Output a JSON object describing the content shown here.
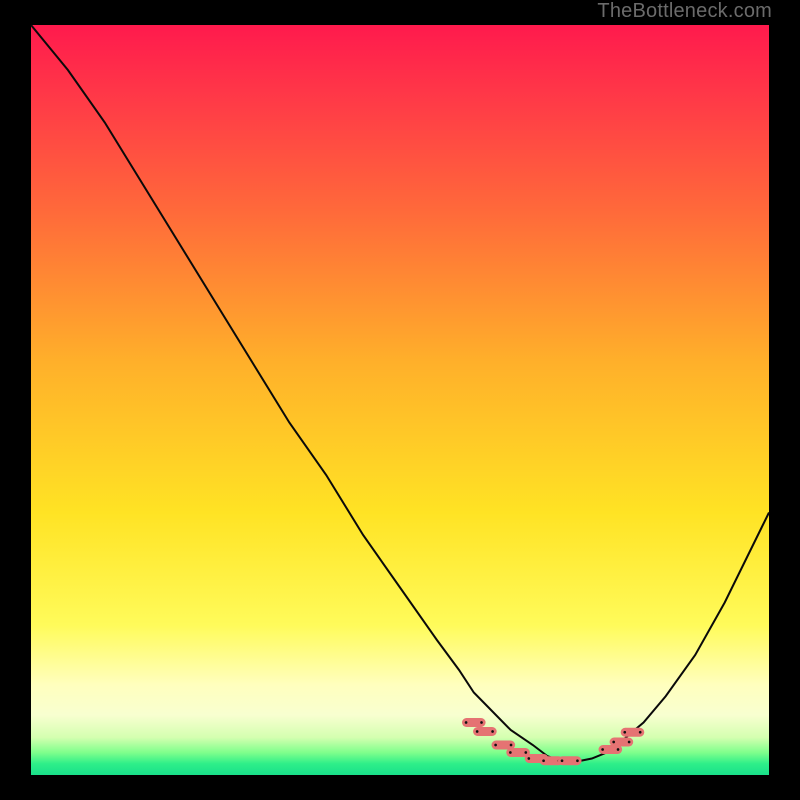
{
  "watermark": "TheBottleneck.com",
  "colors": {
    "black": "#000000",
    "curve": "#0a0a0a",
    "dot_fill": "#e57373",
    "dot_stroke": "#101010"
  },
  "chart_data": {
    "type": "line",
    "title": "",
    "xlabel": "",
    "ylabel": "",
    "xlim": [
      0,
      100
    ],
    "ylim": [
      0,
      100
    ],
    "note": "Axes are unlabeled; values below are percentage positions inside the gradient plot area (0,0 = top-left, 100,100 = bottom-right). Curve depicts a bottleneck-style V shape reaching a minimum near x≈72.",
    "series": [
      {
        "name": "curve",
        "x": [
          0,
          5,
          10,
          15,
          20,
          25,
          30,
          35,
          40,
          45,
          50,
          55,
          58,
          60,
          62,
          65,
          68,
          70,
          72,
          74,
          76,
          78,
          80,
          83,
          86,
          90,
          94,
          97,
          100
        ],
        "y": [
          0,
          6,
          13,
          21,
          29,
          37,
          45,
          53,
          60,
          68,
          75,
          82,
          86,
          89,
          91,
          94,
          96,
          97.5,
          98.2,
          98.2,
          97.8,
          97,
          95.5,
          93,
          89.5,
          84,
          77,
          71,
          65
        ]
      }
    ],
    "dots": {
      "name": "highlight-dots",
      "points": [
        {
          "x": 60.0,
          "y": 93.0
        },
        {
          "x": 61.5,
          "y": 94.2
        },
        {
          "x": 64.0,
          "y": 96.0
        },
        {
          "x": 66.0,
          "y": 97.0
        },
        {
          "x": 68.5,
          "y": 97.8
        },
        {
          "x": 70.5,
          "y": 98.1
        },
        {
          "x": 73.0,
          "y": 98.1
        },
        {
          "x": 78.5,
          "y": 96.6
        },
        {
          "x": 80.0,
          "y": 95.6
        },
        {
          "x": 81.5,
          "y": 94.3
        }
      ],
      "r": 1.1
    }
  }
}
